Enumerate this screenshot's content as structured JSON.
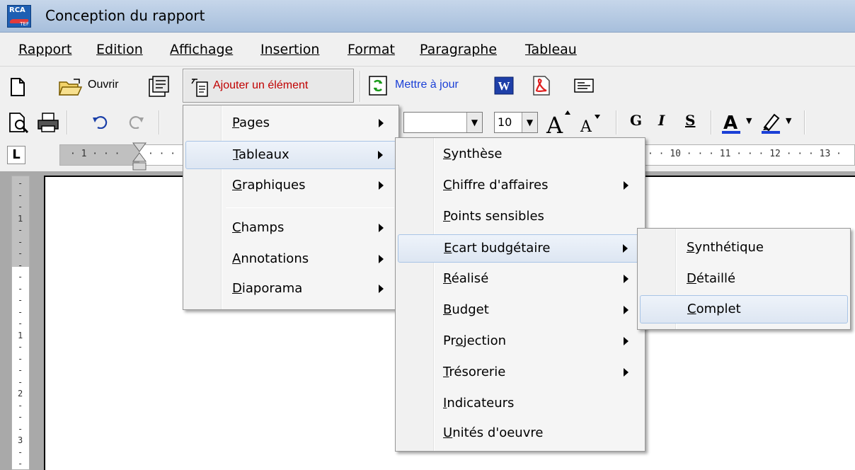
{
  "window": {
    "title": "Conception du rapport",
    "logo_text": "RCA",
    "logo_sub": "TEF"
  },
  "menubar": [
    "Rapport",
    "Edition",
    "Affichage",
    "Insertion",
    "Format",
    "Paragraphe",
    "Tableau"
  ],
  "toolbar1": {
    "open_label": "Ouvrir",
    "add_label": "Ajouter un élément",
    "update_label": "Mettre à jour",
    "add_color": "#c00000",
    "update_color": "#1a3fd6"
  },
  "toolbar2": {
    "font_size": "10",
    "bold_label": "G",
    "italic_label": "I",
    "underline_label": "S"
  },
  "ruler": {
    "h_labels": [
      "1",
      "10",
      "11",
      "12",
      "13"
    ],
    "v_labels": [
      "1",
      "1",
      "2",
      "3"
    ]
  },
  "menu_level1": {
    "items": [
      {
        "label": "Pages",
        "accel": "P",
        "submenu": true
      },
      {
        "label": "Tableaux",
        "accel": "T",
        "submenu": true,
        "highlighted": true
      },
      {
        "label": "Graphiques",
        "accel": "G",
        "submenu": true
      },
      {
        "label": "Champs",
        "accel": "C",
        "submenu": true
      },
      {
        "label": "Annotations",
        "accel": "A",
        "submenu": true
      },
      {
        "label": "Diaporama",
        "accel": "D",
        "submenu": true
      }
    ]
  },
  "menu_level2": {
    "items": [
      {
        "label": "Synthèse",
        "submenu": false
      },
      {
        "label": "Chiffre d'affaires",
        "submenu": true
      },
      {
        "label": "Points sensibles",
        "submenu": false
      },
      {
        "label": "Ecart budgétaire",
        "submenu": true,
        "highlighted": true
      },
      {
        "label": "Réalisé",
        "submenu": true
      },
      {
        "label": "Budget",
        "submenu": true
      },
      {
        "label": "Projection",
        "submenu": true
      },
      {
        "label": "Trésorerie",
        "submenu": true
      },
      {
        "label": "Indicateurs",
        "submenu": false
      },
      {
        "label": "Unités d'oeuvre",
        "submenu": false
      }
    ]
  },
  "menu_level3": {
    "items": [
      {
        "label": "Synthétique"
      },
      {
        "label": "Détaillé"
      },
      {
        "label": "Complet",
        "highlighted": true
      }
    ]
  }
}
